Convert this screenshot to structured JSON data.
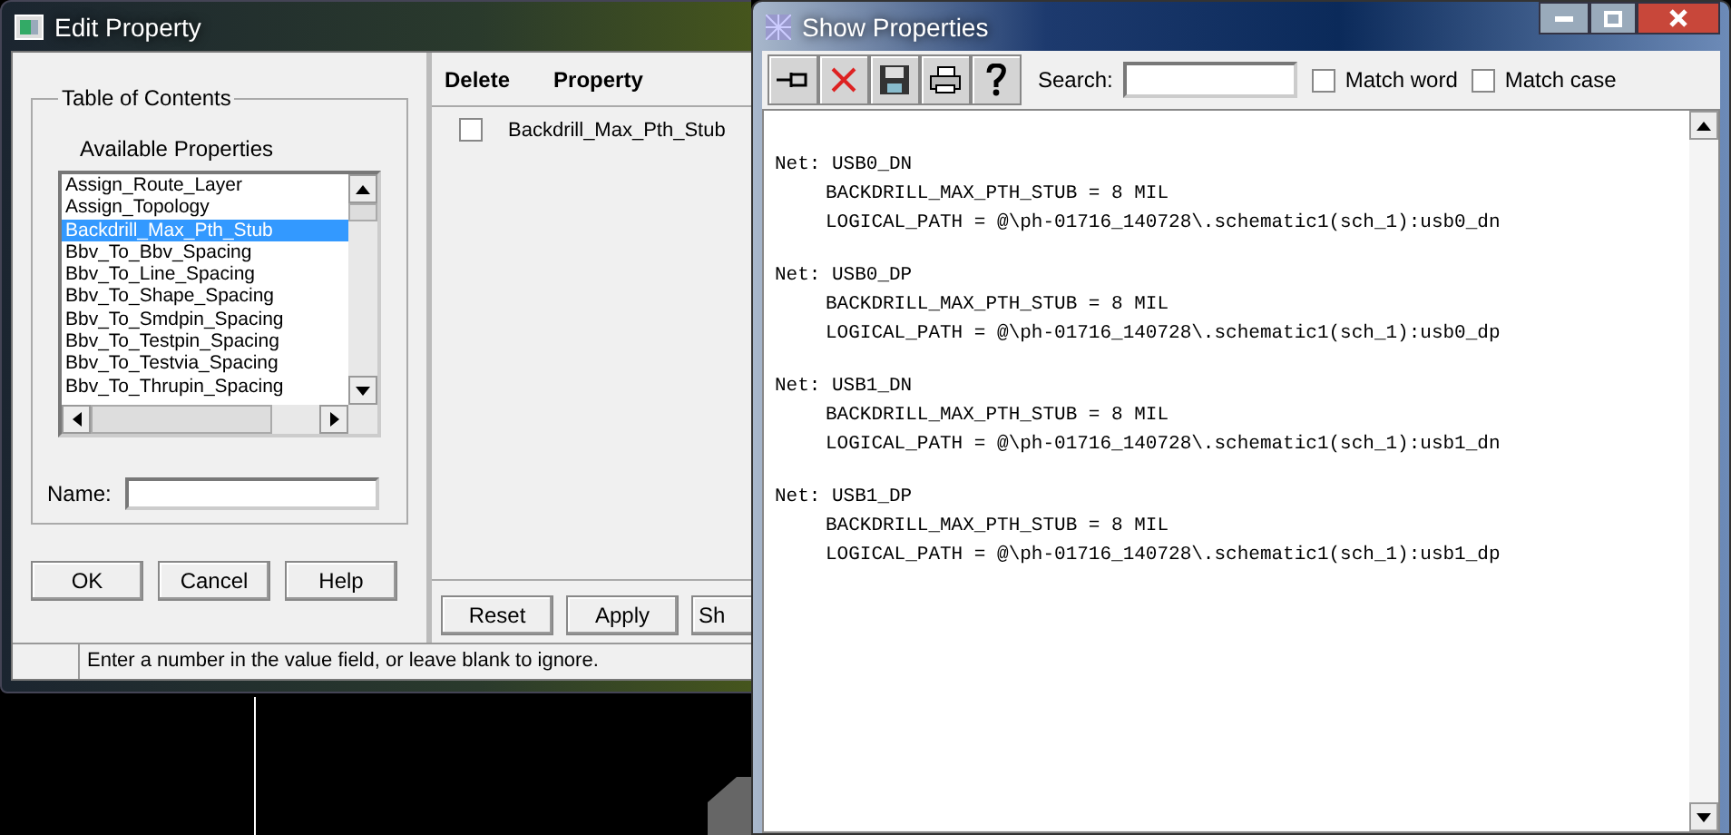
{
  "edit_window": {
    "title": "Edit Property",
    "toc": {
      "title": "Table of Contents",
      "list_label": "Available Properties",
      "items": [
        {
          "label": "Assign_Route_Layer",
          "selected": false
        },
        {
          "label": "Assign_Topology",
          "selected": false
        },
        {
          "label": "Backdrill_Max_Pth_Stub",
          "selected": true
        },
        {
          "label": "Bbv_To_Bbv_Spacing",
          "selected": false
        },
        {
          "label": "Bbv_To_Line_Spacing",
          "selected": false
        },
        {
          "label": "Bbv_To_Shape_Spacing",
          "selected": false
        },
        {
          "label": "Bbv_To_Smdpin_Spacing",
          "selected": false
        },
        {
          "label": "Bbv_To_Testpin_Spacing",
          "selected": false
        },
        {
          "label": "Bbv_To_Testvia_Spacing",
          "selected": false
        },
        {
          "label": "Bbv_To_Thrupin_Spacing",
          "selected": false
        }
      ],
      "name_label": "Name:"
    },
    "buttons": [
      "OK",
      "Cancel",
      "Help"
    ],
    "table": {
      "columns": [
        "Delete",
        "Property"
      ],
      "rows": [
        {
          "checked": false,
          "property": "Backdrill_Max_Pth_Stub"
        }
      ]
    },
    "table_buttons": [
      "Reset",
      "Apply",
      "Sh"
    ],
    "status": "Enter a number in the value field, or leave blank to ignore."
  },
  "show_window": {
    "title": "Show Properties",
    "search_label": "Search:",
    "options": [
      {
        "label": "Match word",
        "checked": false
      },
      {
        "label": "Match case",
        "checked": false
      }
    ],
    "nets": [
      {
        "heading": "Net: USB0_DN",
        "lines": [
          "BACKDRILL_MAX_PTH_STUB = 8 MIL",
          "LOGICAL_PATH = @\\ph-01716_140728\\.schematic1(sch_1):usb0_dn"
        ]
      },
      {
        "heading": "Net: USB0_DP",
        "lines": [
          "BACKDRILL_MAX_PTH_STUB = 8 MIL",
          "LOGICAL_PATH = @\\ph-01716_140728\\.schematic1(sch_1):usb0_dp"
        ]
      },
      {
        "heading": "Net: USB1_DN",
        "lines": [
          "BACKDRILL_MAX_PTH_STUB = 8 MIL",
          "LOGICAL_PATH = @\\ph-01716_140728\\.schematic1(sch_1):usb1_dn"
        ]
      },
      {
        "heading": "Net: USB1_DP",
        "lines": [
          "BACKDRILL_MAX_PTH_STUB = 8 MIL",
          "LOGICAL_PATH = @\\ph-01716_140728\\.schematic1(sch_1):usb1_dp"
        ]
      }
    ]
  }
}
